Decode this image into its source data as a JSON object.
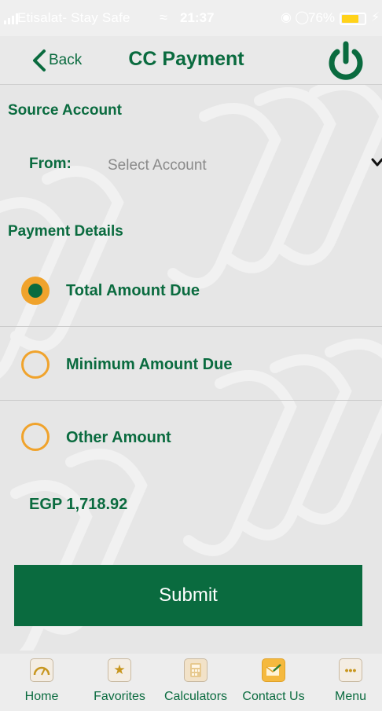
{
  "status_bar": {
    "carrier": "Etisalat- Stay Safe",
    "time": "21:37",
    "battery": "76%",
    "battery_level": 0.76
  },
  "nav": {
    "back_label": "Back",
    "title": "CC Payment",
    "power_icon": "power-icon"
  },
  "source_account": {
    "section_title": "Source Account",
    "from_label": "From:",
    "select_placeholder": "Select Account"
  },
  "payment_details": {
    "section_title": "Payment Details",
    "options": [
      {
        "label": "Total Amount Due",
        "selected": true
      },
      {
        "label": "Minimum Amount Due",
        "selected": false
      },
      {
        "label": "Other Amount",
        "selected": false
      }
    ],
    "amount": "EGP 1,718.92"
  },
  "submit_label": "Submit",
  "tabs": [
    {
      "label": "Home",
      "icon": "speedometer-icon"
    },
    {
      "label": "Favorites",
      "icon": "star-icon"
    },
    {
      "label": "Calculators",
      "icon": "calculator-icon"
    },
    {
      "label": "Contact Us",
      "icon": "envelope-pen-icon"
    },
    {
      "label": "Menu",
      "icon": "more-dots-icon"
    }
  ],
  "colors": {
    "primary_green": "#0a6b3f",
    "radio_orange": "#f0a32c",
    "battery_yellow": "#ffd21a"
  }
}
